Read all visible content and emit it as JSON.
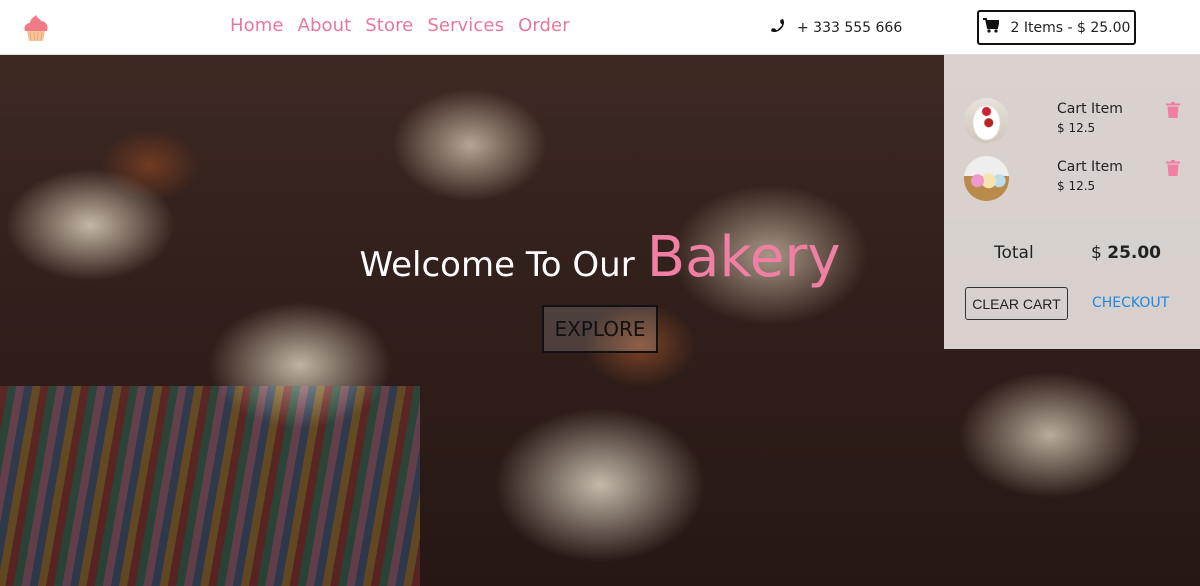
{
  "nav": {
    "logo_icon": "cupcake-icon",
    "links": [
      "Home",
      "About",
      "Store",
      "Services",
      "Order"
    ],
    "phone_icon": "phone-icon",
    "phone": "+ 333 555 666",
    "cart_icon": "cart-icon",
    "cart_summary": "2 Items - $ 25.00"
  },
  "hero": {
    "title_prefix": "Welcome To Our",
    "title_accent": "Bakery",
    "explore_label": "EXPLORE",
    "accent_color": "#ef7fa3"
  },
  "cart": {
    "items": [
      {
        "name": "Cart Item",
        "currency": "$",
        "price": "12.5",
        "image": "cake",
        "remove_icon": "trash-icon"
      },
      {
        "name": "Cart Item",
        "currency": "$",
        "price": "12.5",
        "image": "cupcakes",
        "remove_icon": "trash-icon"
      }
    ],
    "total_label": "Total",
    "total_currency": "$",
    "total_value": "25.00",
    "clear_label": "CLEAR CART",
    "checkout_label": "CHECKOUT"
  }
}
